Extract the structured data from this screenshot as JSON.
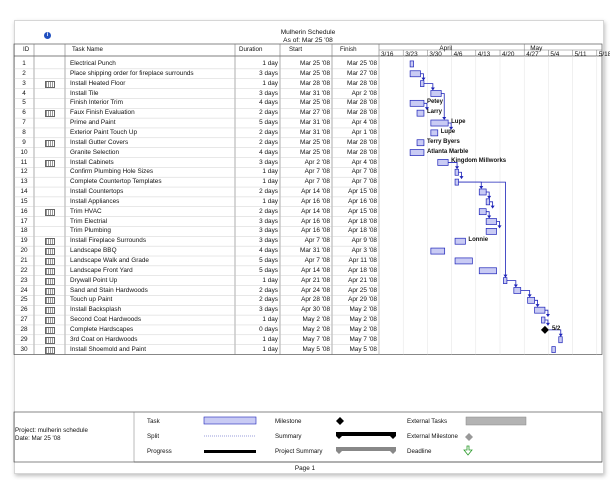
{
  "header": {
    "title": "Mulherin Schedule",
    "as_of": "As of: Mar 25 '08"
  },
  "columns": {
    "id": "ID",
    "task_name": "Task Name",
    "duration": "Duration",
    "start": "Start",
    "finish": "Finish"
  },
  "timescale": {
    "months": [
      "April",
      "May"
    ],
    "weeks": [
      "3/16",
      "3/23",
      "3/30",
      "4/6",
      "4/13",
      "4/20",
      "4/27",
      "5/4",
      "5/11",
      "5/18"
    ],
    "week_start_dates": [
      "2008-03-16",
      "2008-03-23",
      "2008-03-30",
      "2008-04-06",
      "2008-04-13",
      "2008-04-20",
      "2008-04-27",
      "2008-05-04",
      "2008-05-11",
      "2008-05-18"
    ]
  },
  "tasks": [
    {
      "id": "1",
      "name": "Electrical Punch",
      "duration": "1 day",
      "start": "Mar 25 '08",
      "finish": "Mar 25 '08",
      "start_date": "2008-03-25",
      "finish_date": "2008-03-25",
      "indicator": false,
      "resource": ""
    },
    {
      "id": "2",
      "name": "Place shipping order for fireplace surrounds",
      "duration": "3 days",
      "start": "Mar 25 '08",
      "finish": "Mar 27 '08",
      "start_date": "2008-03-25",
      "finish_date": "2008-03-27",
      "indicator": false,
      "resource": ""
    },
    {
      "id": "3",
      "name": "Install Heated Floor",
      "duration": "1 day",
      "start": "Mar 28 '08",
      "finish": "Mar 28 '08",
      "start_date": "2008-03-28",
      "finish_date": "2008-03-28",
      "indicator": true,
      "resource": ""
    },
    {
      "id": "4",
      "name": "Install Tile",
      "duration": "3 days",
      "start": "Mar 31 '08",
      "finish": "Apr 2 '08",
      "start_date": "2008-03-31",
      "finish_date": "2008-04-02",
      "indicator": false,
      "resource": ""
    },
    {
      "id": "5",
      "name": "Finish Interior Trim",
      "duration": "4 days",
      "start": "Mar 25 '08",
      "finish": "Mar 28 '08",
      "start_date": "2008-03-25",
      "finish_date": "2008-03-28",
      "indicator": false,
      "resource": "Petey"
    },
    {
      "id": "6",
      "name": "Faux Finish Evaluation",
      "duration": "2 days",
      "start": "Mar 27 '08",
      "finish": "Mar 28 '08",
      "start_date": "2008-03-27",
      "finish_date": "2008-03-28",
      "indicator": true,
      "resource": "Larry"
    },
    {
      "id": "7",
      "name": "Prime and Paint",
      "duration": "5 days",
      "start": "Mar 31 '08",
      "finish": "Apr 4 '08",
      "start_date": "2008-03-31",
      "finish_date": "2008-04-04",
      "indicator": false,
      "resource": "Lupe"
    },
    {
      "id": "8",
      "name": "Exterior Paint Touch Up",
      "duration": "2 days",
      "start": "Mar 31 '08",
      "finish": "Apr 1 '08",
      "start_date": "2008-03-31",
      "finish_date": "2008-04-01",
      "indicator": false,
      "resource": "Lupe"
    },
    {
      "id": "9",
      "name": "Install Gutter Covers",
      "duration": "2 days",
      "start": "Mar 25 '08",
      "finish": "Mar 28 '08",
      "start_date": "2008-03-27",
      "finish_date": "2008-03-28",
      "indicator": true,
      "resource": "Terry Byers"
    },
    {
      "id": "10",
      "name": "Granite Selection",
      "duration": "4 days",
      "start": "Mar 25 '08",
      "finish": "Mar 28 '08",
      "start_date": "2008-03-25",
      "finish_date": "2008-03-28",
      "indicator": false,
      "resource": "Atlanta Marble"
    },
    {
      "id": "11",
      "name": "Install Cabinets",
      "duration": "3 days",
      "start": "Apr 2 '08",
      "finish": "Apr 4 '08",
      "start_date": "2008-04-02",
      "finish_date": "2008-04-04",
      "indicator": true,
      "resource": "Kingdom Millworks"
    },
    {
      "id": "12",
      "name": "Confirm Plumbing Hole Sizes",
      "duration": "1 day",
      "start": "Apr 7 '08",
      "finish": "Apr 7 '08",
      "start_date": "2008-04-07",
      "finish_date": "2008-04-07",
      "indicator": false,
      "resource": ""
    },
    {
      "id": "13",
      "name": "Complete Countertop Templates",
      "duration": "1 day",
      "start": "Apr 7 '08",
      "finish": "Apr 7 '08",
      "start_date": "2008-04-07",
      "finish_date": "2008-04-07",
      "indicator": false,
      "resource": ""
    },
    {
      "id": "14",
      "name": "Install Countertops",
      "duration": "2 days",
      "start": "Apr 14 '08",
      "finish": "Apr 15 '08",
      "start_date": "2008-04-14",
      "finish_date": "2008-04-15",
      "indicator": false,
      "resource": ""
    },
    {
      "id": "15",
      "name": "Install Appliances",
      "duration": "1 day",
      "start": "Apr 16 '08",
      "finish": "Apr 16 '08",
      "start_date": "2008-04-16",
      "finish_date": "2008-04-16",
      "indicator": false,
      "resource": ""
    },
    {
      "id": "16",
      "name": "Trim HVAC",
      "duration": "2 days",
      "start": "Apr 14 '08",
      "finish": "Apr 15 '08",
      "start_date": "2008-04-14",
      "finish_date": "2008-04-15",
      "indicator": true,
      "resource": ""
    },
    {
      "id": "17",
      "name": "Trim Electrial",
      "duration": "3 days",
      "start": "Apr 16 '08",
      "finish": "Apr 18 '08",
      "start_date": "2008-04-16",
      "finish_date": "2008-04-18",
      "indicator": false,
      "resource": ""
    },
    {
      "id": "18",
      "name": "Trim Plumbing",
      "duration": "3 days",
      "start": "Apr 16 '08",
      "finish": "Apr 18 '08",
      "start_date": "2008-04-16",
      "finish_date": "2008-04-18",
      "indicator": false,
      "resource": ""
    },
    {
      "id": "19",
      "name": "Install Fireplace Surrounds",
      "duration": "3 days",
      "start": "Apr 7 '08",
      "finish": "Apr 9 '08",
      "start_date": "2008-04-07",
      "finish_date": "2008-04-09",
      "indicator": true,
      "resource": "Lonnie"
    },
    {
      "id": "20",
      "name": "Landscape BBQ",
      "duration": "4 days",
      "start": "Mar 31 '08",
      "finish": "Apr 3 '08",
      "start_date": "2008-03-31",
      "finish_date": "2008-04-03",
      "indicator": true,
      "resource": ""
    },
    {
      "id": "21",
      "name": "Landscape Walk and Grade",
      "duration": "5 days",
      "start": "Apr 7 '08",
      "finish": "Apr 11 '08",
      "start_date": "2008-04-07",
      "finish_date": "2008-04-11",
      "indicator": true,
      "resource": ""
    },
    {
      "id": "22",
      "name": "Landscape Front Yard",
      "duration": "5 days",
      "start": "Apr 14 '08",
      "finish": "Apr 18 '08",
      "start_date": "2008-04-14",
      "finish_date": "2008-04-18",
      "indicator": true,
      "resource": ""
    },
    {
      "id": "23",
      "name": "Drywall Point Up",
      "duration": "1 day",
      "start": "Apr 21 '08",
      "finish": "Apr 21 '08",
      "start_date": "2008-04-21",
      "finish_date": "2008-04-21",
      "indicator": true,
      "resource": ""
    },
    {
      "id": "24",
      "name": "Sand and Stain Hardwoods",
      "duration": "2 days",
      "start": "Apr 24 '08",
      "finish": "Apr 25 '08",
      "start_date": "2008-04-24",
      "finish_date": "2008-04-25",
      "indicator": true,
      "resource": ""
    },
    {
      "id": "25",
      "name": "Touch up Paint",
      "duration": "2 days",
      "start": "Apr 28 '08",
      "finish": "Apr 29 '08",
      "start_date": "2008-04-28",
      "finish_date": "2008-04-29",
      "indicator": true,
      "resource": ""
    },
    {
      "id": "26",
      "name": "Install Backsplash",
      "duration": "3 days",
      "start": "Apr 30 '08",
      "finish": "May 2 '08",
      "start_date": "2008-04-30",
      "finish_date": "2008-05-02",
      "indicator": true,
      "resource": ""
    },
    {
      "id": "27",
      "name": "Second Coat Hardwoods",
      "duration": "1 day",
      "start": "May 2 '08",
      "finish": "May 2 '08",
      "start_date": "2008-05-02",
      "finish_date": "2008-05-02",
      "indicator": true,
      "resource": ""
    },
    {
      "id": "28",
      "name": "Complete Hardscapes",
      "duration": "0 days",
      "start": "May 2 '08",
      "finish": "May 2 '08",
      "start_date": "2008-05-02",
      "finish_date": "2008-05-02",
      "indicator": true,
      "milestone": true,
      "resource": "5/2"
    },
    {
      "id": "29",
      "name": "3rd Coat on Hardwoods",
      "duration": "1 day",
      "start": "May 7 '08",
      "finish": "May 7 '08",
      "start_date": "2008-05-07",
      "finish_date": "2008-05-07",
      "indicator": true,
      "resource": ""
    },
    {
      "id": "30",
      "name": "Install Shoemold and Paint",
      "duration": "1 day",
      "start": "May 5 '08",
      "finish": "May 5 '08",
      "start_date": "2008-05-05",
      "finish_date": "2008-05-05",
      "indicator": true,
      "resource": ""
    }
  ],
  "dependencies": [
    [
      2,
      3
    ],
    [
      3,
      4
    ],
    [
      4,
      7
    ],
    [
      5,
      6
    ],
    [
      7,
      8
    ],
    [
      11,
      12
    ],
    [
      12,
      13
    ],
    [
      13,
      14
    ],
    [
      14,
      15
    ],
    [
      15,
      16
    ],
    [
      16,
      17
    ],
    [
      17,
      18
    ],
    [
      13,
      23
    ],
    [
      23,
      24
    ],
    [
      24,
      25
    ],
    [
      25,
      26
    ],
    [
      26,
      27
    ],
    [
      27,
      28
    ],
    [
      28,
      29
    ]
  ],
  "project_info": {
    "project": "Project: mulherin schedule",
    "date": "Date: Mar 25 '08"
  },
  "legend": {
    "task": "Task",
    "split": "Split",
    "progress": "Progress",
    "milestone": "Milestone",
    "summary": "Summary",
    "project_summary": "Project Summary",
    "external_tasks": "External Tasks",
    "external_milestone": "External Milestone",
    "deadline": "Deadline"
  },
  "footer": {
    "page": "Page 1"
  },
  "colors": {
    "bar_fill": "#c9cbf4",
    "bar_border": "#1d23b8",
    "link": "#1d23b8",
    "grid": "#9a9a9a",
    "external": "#b3b3b3",
    "deadline": "#2a9a2a"
  }
}
